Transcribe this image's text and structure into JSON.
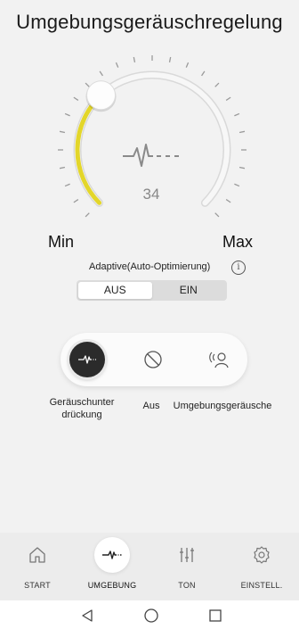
{
  "header": {
    "title": "Umgebungsgeräuschregelung"
  },
  "dial": {
    "value": "34",
    "level_fraction": 0.34,
    "min_label": "Min",
    "max_label": "Max",
    "center_icon": "waveform-icon",
    "accent_color": "#e3d62a"
  },
  "adaptive": {
    "label": "Adaptive(Auto-Optimierung)",
    "info_icon": "info-icon",
    "info_glyph": "i",
    "options": [
      "AUS",
      "EIN"
    ],
    "selected": "AUS"
  },
  "modes": {
    "items": [
      {
        "label_line1": "Geräuschunter",
        "label_line2": "drückung",
        "icon": "noise-cancel-icon",
        "active": true
      },
      {
        "label": "Aus",
        "icon": "off-icon",
        "active": false
      },
      {
        "label": "Umgebungsgeräusche",
        "icon": "ambient-sound-icon",
        "active": false
      }
    ]
  },
  "nav": {
    "items": [
      {
        "label": "START",
        "icon": "home-icon",
        "active": false
      },
      {
        "label": "UMGEBUNG",
        "icon": "waveform-icon",
        "active": true
      },
      {
        "label": "TON",
        "icon": "equalizer-icon",
        "active": false
      },
      {
        "label": "EINSTELL.",
        "icon": "gear-icon",
        "active": false
      }
    ]
  },
  "system_bar": {
    "buttons": [
      "back-icon",
      "home-circle-icon",
      "recents-icon"
    ]
  }
}
